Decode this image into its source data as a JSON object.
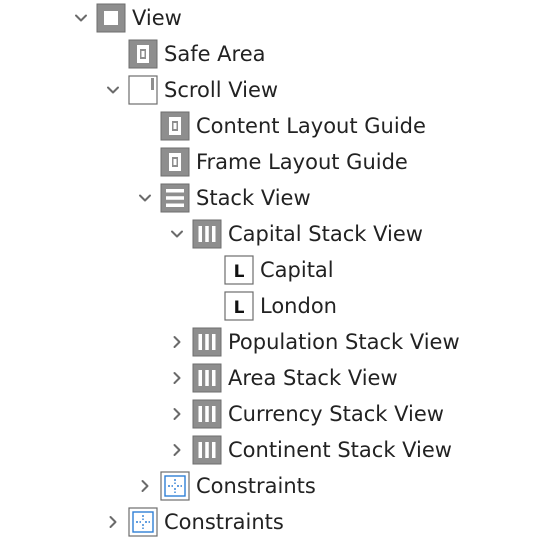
{
  "tree": {
    "items": [
      {
        "label": "View",
        "depth": 0,
        "disclosure": "open",
        "icon": "view-icon"
      },
      {
        "label": "Safe Area",
        "depth": 1,
        "disclosure": "none",
        "icon": "layout-guide-icon"
      },
      {
        "label": "Scroll View",
        "depth": 1,
        "disclosure": "open",
        "icon": "scroll-view-icon"
      },
      {
        "label": "Content Layout Guide",
        "depth": 2,
        "disclosure": "none",
        "icon": "layout-guide-icon"
      },
      {
        "label": "Frame Layout Guide",
        "depth": 2,
        "disclosure": "none",
        "icon": "layout-guide-icon"
      },
      {
        "label": "Stack View",
        "depth": 2,
        "disclosure": "open",
        "icon": "vertical-stack-icon"
      },
      {
        "label": "Capital Stack View",
        "depth": 3,
        "disclosure": "open",
        "icon": "horizontal-stack-icon"
      },
      {
        "label": "Capital",
        "depth": 4,
        "disclosure": "none",
        "icon": "label-icon"
      },
      {
        "label": "London",
        "depth": 4,
        "disclosure": "none",
        "icon": "label-icon"
      },
      {
        "label": "Population Stack View",
        "depth": 3,
        "disclosure": "closed",
        "icon": "horizontal-stack-icon"
      },
      {
        "label": "Area Stack View",
        "depth": 3,
        "disclosure": "closed",
        "icon": "horizontal-stack-icon"
      },
      {
        "label": "Currency Stack View",
        "depth": 3,
        "disclosure": "closed",
        "icon": "horizontal-stack-icon"
      },
      {
        "label": "Continent Stack View",
        "depth": 3,
        "disclosure": "closed",
        "icon": "horizontal-stack-icon"
      },
      {
        "label": "Constraints",
        "depth": 2,
        "disclosure": "closed",
        "icon": "constraints-icon"
      },
      {
        "label": "Constraints",
        "depth": 1,
        "disclosure": "closed",
        "icon": "constraints-icon"
      }
    ],
    "label_glyph": "L",
    "colors": {
      "icon_gray": "#8e8e8e",
      "icon_border": "#6d6d6d",
      "constraint_blue": "#2f7fd6",
      "chevron": "#6b6b6b"
    }
  }
}
